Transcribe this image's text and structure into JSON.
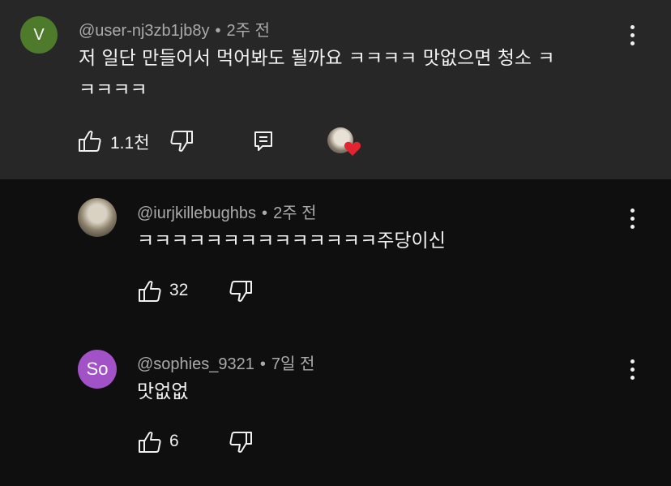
{
  "comments": [
    {
      "avatar_letter": "V",
      "avatar_color": "#4e7a2c",
      "username": "@user-nj3zb1jb8y",
      "time": "2주 전",
      "text_line1": "저 일단 만들어서 먹어봐도 될까요 ㅋㅋㅋㅋ 맛없으면 청소 ㅋ",
      "text_line2": "ㅋㅋㅋㅋ",
      "likes": "1.1천",
      "creator_heart": true
    },
    {
      "username": "@iurjkillebughbs",
      "time": "2주 전",
      "text": "ㅋㅋㅋㅋㅋㅋㅋㅋㅋㅋㅋㅋㅋㅋ주당이신",
      "likes": "32"
    },
    {
      "avatar_letter": "So",
      "avatar_color": "#a252c7",
      "username": "@sophies_9321",
      "time": "7일 전",
      "text": "맛없없",
      "likes": "6"
    }
  ],
  "colors": {
    "background": "#0f0f0f",
    "highlight": "#272727",
    "heart": "#e3232e"
  }
}
